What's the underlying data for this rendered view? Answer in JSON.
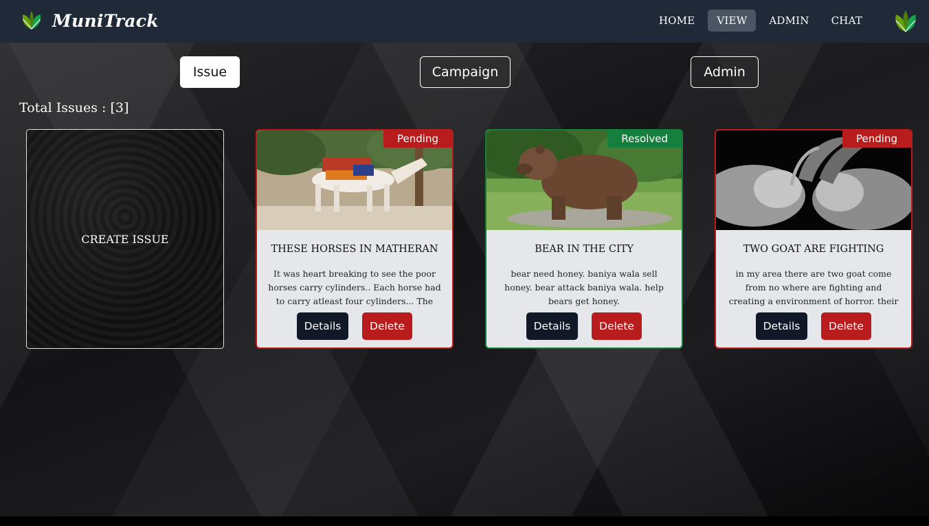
{
  "navbar": {
    "brand": "MuniTrack",
    "links": [
      {
        "label": "HOME",
        "active": false
      },
      {
        "label": "VIEW",
        "active": true
      },
      {
        "label": "ADMIN",
        "active": false
      },
      {
        "label": "CHAT",
        "active": false
      }
    ],
    "logo_icon": "leaf-logo-icon",
    "colors": {
      "bar": "#1f2937",
      "active_link": "#4b5563"
    }
  },
  "tabs": [
    {
      "label": "Issue",
      "active": true
    },
    {
      "label": "Campaign",
      "active": false
    },
    {
      "label": "Admin",
      "active": false
    }
  ],
  "summary": {
    "label": "Total Issues : ",
    "count": "[3]"
  },
  "create_card": {
    "label": "CREATE ISSUE"
  },
  "issues": [
    {
      "status": "Pending",
      "title": "THESE HORSES IN MATHERAN",
      "description": "It was heart breaking to see the poor horses carry cylinders.. Each horse had to carry atleast four cylinders... The",
      "image": "horse-photo",
      "details_label": "Details",
      "delete_label": "Delete"
    },
    {
      "status": "Resolved",
      "title": "BEAR IN THE CITY",
      "description": "bear need honey. baniya wala sell honey. bear attack baniya wala. help bears get honey.",
      "image": "bear-photo",
      "details_label": "Details",
      "delete_label": "Delete"
    },
    {
      "status": "Pending",
      "title": "TWO GOAT ARE FIGHTING",
      "description": "in my area there are two goat come from no where are fighting and creating a environment of horror. their horn are so",
      "image": "goats-photo",
      "details_label": "Details",
      "delete_label": "Delete"
    }
  ],
  "colors": {
    "pending": "#b91c1c",
    "resolved": "#15803d",
    "card_bg": "#e5e7eb",
    "details_button": "#111827"
  }
}
